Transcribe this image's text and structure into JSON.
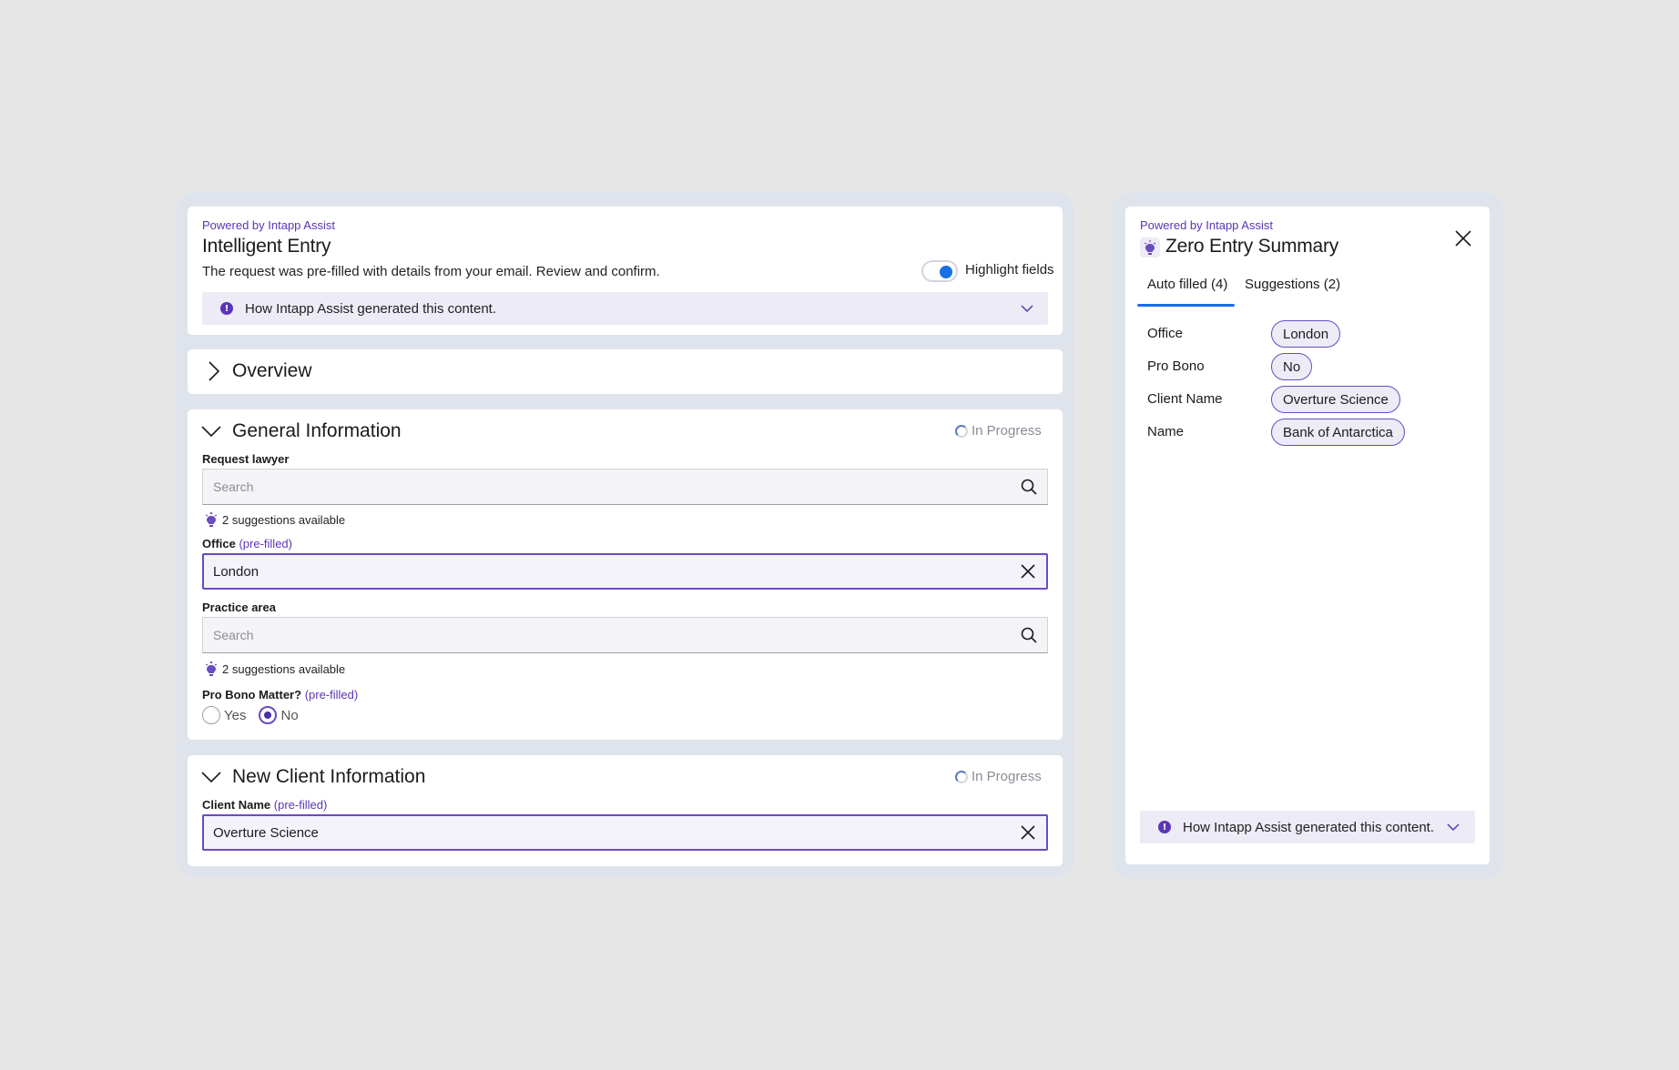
{
  "entry": {
    "powered_by": "Powered by Intapp Assist",
    "title": "Intelligent Entry",
    "subtitle": "The request was pre-filled with details from your email. Review and confirm.",
    "toggle_label": "Highlight fields",
    "info_text": "How Intapp Assist generated this content."
  },
  "overview": {
    "title": "Overview"
  },
  "general": {
    "title": "General Information",
    "status": "In Progress",
    "request_lawyer_label": "Request lawyer",
    "request_lawyer_placeholder": "Search",
    "request_lawyer_suggestions": "2 suggestions available",
    "office_label": "Office",
    "office_prefilled": "(pre-filled)",
    "office_value": "London",
    "practice_label": "Practice area",
    "practice_placeholder": "Search",
    "practice_suggestions": "2 suggestions available",
    "probono_label": "Pro Bono Matter?",
    "probono_prefilled": "(pre-filled)",
    "probono_yes": "Yes",
    "probono_no": "No",
    "probono_selected": "No"
  },
  "new_client": {
    "title": "New Client Information",
    "status": "In Progress",
    "client_label": "Client Name",
    "client_prefilled": "(pre-filled)",
    "client_value": "Overture Science"
  },
  "summary": {
    "powered_by": "Powered by Intapp Assist",
    "title": "Zero Entry Summary",
    "tabs": [
      {
        "label": "Auto filled (4)",
        "active": true
      },
      {
        "label": "Suggestions (2)",
        "active": false
      }
    ],
    "rows": [
      {
        "label": "Office",
        "value": "London"
      },
      {
        "label": "Pro Bono",
        "value": "No"
      },
      {
        "label": "Client Name",
        "value": "Overture Science"
      },
      {
        "label": "Name",
        "value": "Bank of Antarctica"
      }
    ],
    "info_text": "How Intapp Assist generated this content."
  },
  "colors": {
    "accent": "#5a35b6",
    "toggle": "#1a6ee6",
    "tab_underline": "#1a6ee6"
  }
}
